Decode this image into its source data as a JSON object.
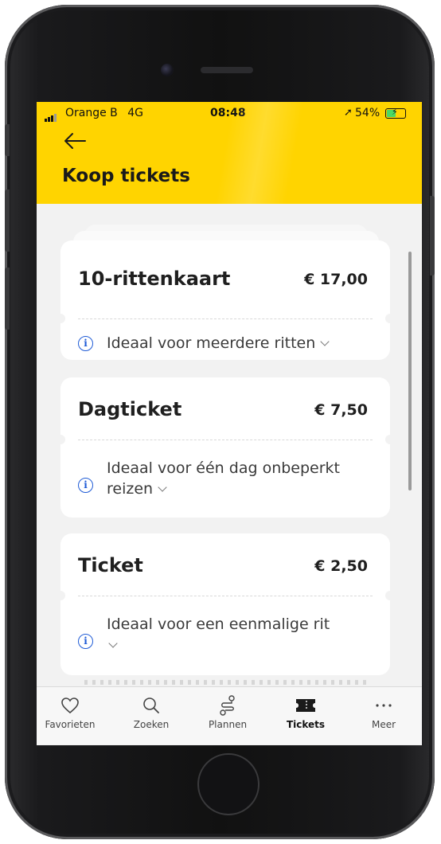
{
  "status_bar": {
    "carrier": "Orange B",
    "network": "4G",
    "time": "08:48",
    "battery": "54%",
    "battery_level": 0.54
  },
  "header": {
    "title": "Koop tickets",
    "background_color": "#ffd400"
  },
  "tickets": [
    {
      "title": "10-rittenkaart",
      "price": "€ 17,00",
      "description": "Ideaal voor meerdere ritten"
    },
    {
      "title": "Dagticket",
      "price": "€ 7,50",
      "description": "Ideaal voor één dag onbeperkt reizen"
    },
    {
      "title": "Ticket",
      "price": "€ 2,50",
      "description": "Ideaal voor een eenmalige rit"
    }
  ],
  "tabbar": {
    "items": [
      {
        "label": "Favorieten",
        "icon": "heart-icon"
      },
      {
        "label": "Zoeken",
        "icon": "search-icon"
      },
      {
        "label": "Plannen",
        "icon": "route-icon"
      },
      {
        "label": "Tickets",
        "icon": "ticket-icon",
        "active": true
      },
      {
        "label": "Meer",
        "icon": "more-icon"
      }
    ]
  },
  "colors": {
    "accent_yellow": "#ffd400",
    "info_blue": "#1f5bd6",
    "battery_green": "#4cd964"
  }
}
